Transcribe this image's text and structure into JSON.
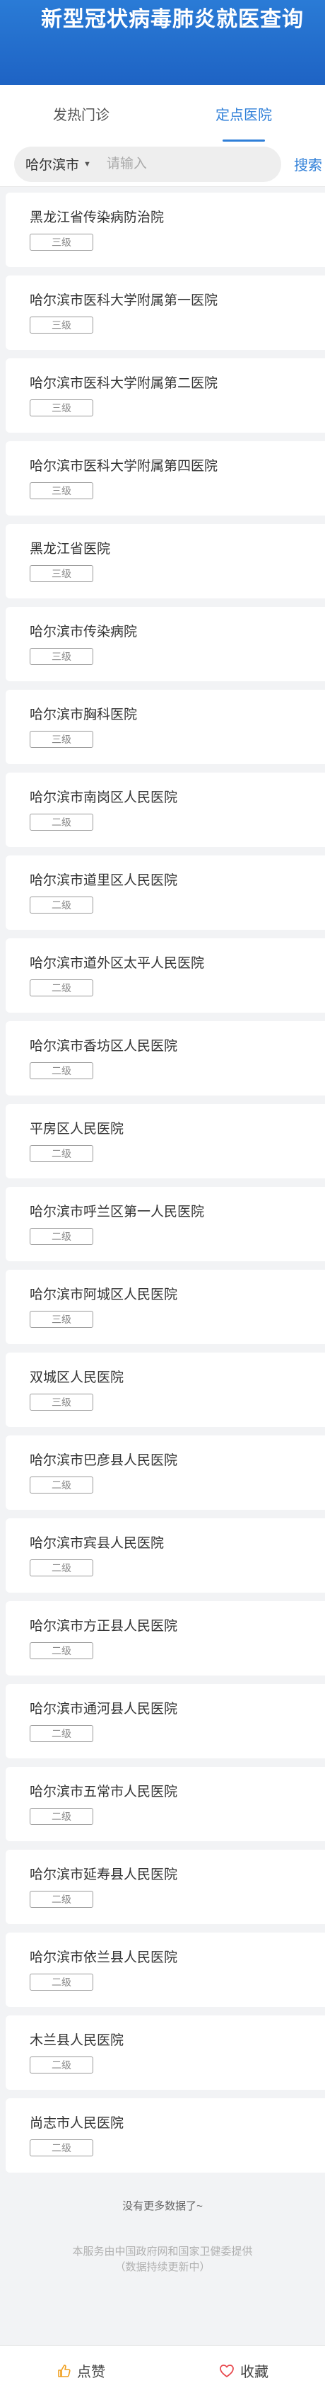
{
  "header": {
    "title": "新型冠状病毒肺炎就医查询"
  },
  "tabs": [
    {
      "label": "发热门诊",
      "active": false
    },
    {
      "label": "定点医院",
      "active": true
    }
  ],
  "search": {
    "city": "哈尔滨市",
    "placeholder": "请输入",
    "value": "",
    "button_label": "搜索"
  },
  "hospitals": [
    {
      "name": "黑龙江省传染病防治院",
      "level": "三级"
    },
    {
      "name": "哈尔滨市医科大学附属第一医院",
      "level": "三级"
    },
    {
      "name": "哈尔滨市医科大学附属第二医院",
      "level": "三级"
    },
    {
      "name": "哈尔滨市医科大学附属第四医院",
      "level": "三级"
    },
    {
      "name": "黑龙江省医院",
      "level": "三级"
    },
    {
      "name": "哈尔滨市传染病院",
      "level": "三级"
    },
    {
      "name": "哈尔滨市胸科医院",
      "level": "三级"
    },
    {
      "name": "哈尔滨市南岗区人民医院",
      "level": "二级"
    },
    {
      "name": "哈尔滨市道里区人民医院",
      "level": "二级"
    },
    {
      "name": "哈尔滨市道外区太平人民医院",
      "level": "二级"
    },
    {
      "name": "哈尔滨市香坊区人民医院",
      "level": "二级"
    },
    {
      "name": "平房区人民医院",
      "level": "二级"
    },
    {
      "name": "哈尔滨市呼兰区第一人民医院",
      "level": "二级"
    },
    {
      "name": "哈尔滨市阿城区人民医院",
      "level": "三级"
    },
    {
      "name": "双城区人民医院",
      "level": "三级"
    },
    {
      "name": "哈尔滨市巴彦县人民医院",
      "level": "二级"
    },
    {
      "name": "哈尔滨市宾县人民医院",
      "level": "二级"
    },
    {
      "name": "哈尔滨市方正县人民医院",
      "level": "二级"
    },
    {
      "name": "哈尔滨市通河县人民医院",
      "level": "二级"
    },
    {
      "name": "哈尔滨市五常市人民医院",
      "level": "二级"
    },
    {
      "name": "哈尔滨市延寿县人民医院",
      "level": "二级"
    },
    {
      "name": "哈尔滨市依兰县人民医院",
      "level": "二级"
    },
    {
      "name": "木兰县人民医院",
      "level": "二级"
    },
    {
      "name": "尚志市人民医院",
      "level": "二级"
    }
  ],
  "list_end_text": "没有更多数据了~",
  "footnote": {
    "line1": "本服务由中国政府网和国家卫健委提供",
    "line2": "（数据持续更新中）"
  },
  "footer": {
    "like_label": "点赞",
    "like_icon": "thumbs-up-icon",
    "favorite_label": "收藏",
    "favorite_icon": "heart-icon"
  },
  "colors": {
    "brand": "#1e63c4",
    "accent": "#2f7fd8",
    "like_icon": "#f0a020",
    "heart_icon": "#e8474c"
  }
}
